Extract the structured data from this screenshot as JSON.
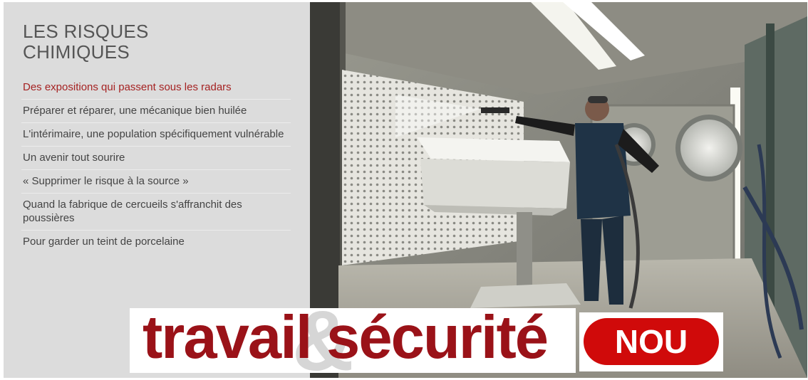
{
  "sidebar": {
    "title_line1": "LES RISQUES",
    "title_line2": "CHIMIQUES",
    "items": [
      {
        "label": "Des expositions qui passent sous les radars"
      },
      {
        "label": "Préparer et réparer, une mécanique bien huilée"
      },
      {
        "label": "L'intérimaire, une population spécifiquement vulnérable"
      },
      {
        "label": "Un avenir tout sourire"
      },
      {
        "label": "« Supprimer le risque à la source »"
      },
      {
        "label": "Quand la fabrique de cercueils s'affranchit des poussières"
      },
      {
        "label": "Pour garder un teint de porcelaine"
      }
    ]
  },
  "banner": {
    "logo_text": "travail sécurité",
    "badge_text": "NOU"
  },
  "colors": {
    "active_link": "#a52222",
    "banner_red": "#9a1218",
    "badge_red": "#d00a0a"
  }
}
